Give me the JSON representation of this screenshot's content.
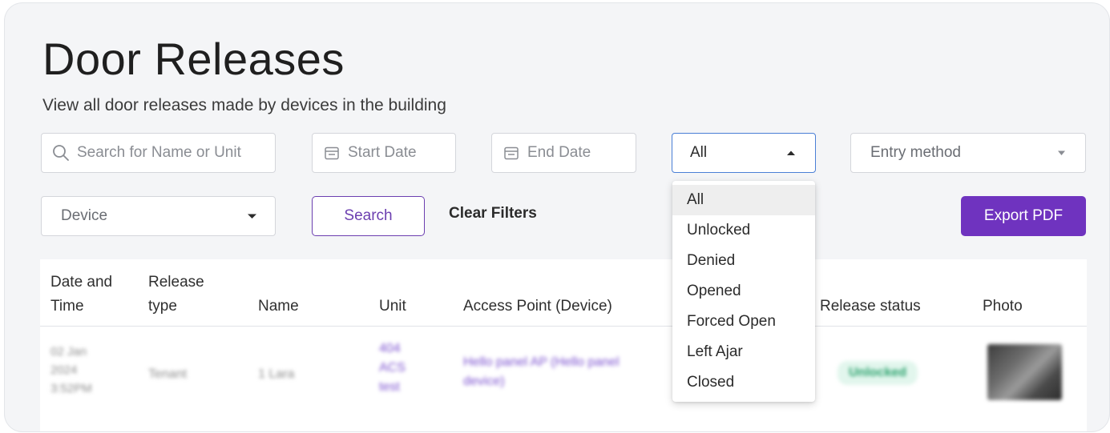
{
  "page": {
    "title": "Door Releases",
    "subtitle": "View all door releases made by devices in the building"
  },
  "filters": {
    "search_placeholder": "Search for Name or Unit",
    "start_date_placeholder": "Start Date",
    "end_date_placeholder": "End Date",
    "status_selected": "All",
    "entry_method_placeholder": "Entry method",
    "device_placeholder": "Device",
    "search_button": "Search",
    "clear_filters": "Clear Filters",
    "export_button": "Export PDF"
  },
  "status_dropdown": {
    "options": [
      "All",
      "Unlocked",
      "Denied",
      "Opened",
      "Forced Open",
      "Left Ajar",
      "Closed"
    ]
  },
  "table": {
    "headers": {
      "date_line1": "Date and",
      "date_line2": "Time",
      "type_line1": "Release",
      "type_line2": "type",
      "name": "Name",
      "unit": "Unit",
      "access_point": "Access Point (Device)",
      "status": "Release status",
      "photo": "Photo"
    },
    "rows": [
      {
        "date_line1": "02 Jan",
        "date_line2": "2024",
        "date_line3": "3:52PM",
        "type": "Tenant",
        "name": "1 Lara",
        "unit_line1": "404",
        "unit_line2": "ACS",
        "unit_line3": "test",
        "access_line1": "Hello panel AP (Hello panel",
        "access_line2": "device)",
        "status": "Unlocked"
      }
    ]
  },
  "colors": {
    "accent": "#6f33bf",
    "focus_border": "#4a7fd6",
    "status_unlocked_bg": "#e2f6ed",
    "status_unlocked_text": "#27a06a"
  }
}
